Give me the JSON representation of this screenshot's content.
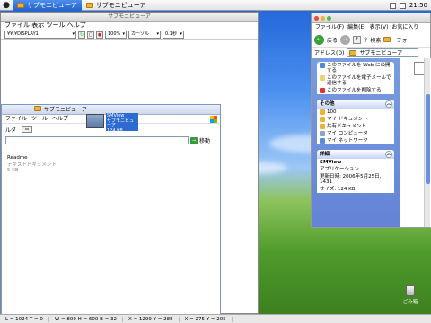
{
  "menubar": {
    "items": [
      "サブモニビューア",
      "サブモニビューア"
    ],
    "clock": "21:50"
  },
  "viewer": {
    "title": "サブモニビューア",
    "menu": "ファイル 表示 ツール ヘルプ",
    "path": "¥¥.¥DISPLAY1",
    "zoom": "100%",
    "cursor_mode": "カーソル",
    "interval": "0.1秒"
  },
  "inner": {
    "title": "サブモニビューア",
    "menu": [
      "ファイル",
      "ツール",
      "ヘルプ"
    ],
    "toolbar_left": "ルダ",
    "go_label": "移動",
    "files": [
      {
        "name": "Readme",
        "type": "テキストドキュメント",
        "size": "5 KB"
      },
      {
        "name": "SMView",
        "type": "サブモニビューア",
        "size": "124 KB"
      }
    ]
  },
  "explorer": {
    "menu": [
      "ファイル(F)",
      "編集(E)",
      "表示(V)",
      "お気に入り"
    ],
    "back": "戻る",
    "search": "検索",
    "folder": "フォ",
    "address_label": "アドレス(D)",
    "address_value": "サブモニビューア",
    "tasks": [
      "このファイルを Web に公開する",
      "このファイルを電子メールで送信する",
      "このファイルを削除する"
    ],
    "other_title": "その他",
    "other_places": [
      "100",
      "マイ ドキュメント",
      "共有ドキュメント",
      "マイ コンピュータ",
      "マイ ネットワーク"
    ],
    "details_title": "詳細",
    "details": {
      "name": "SMView",
      "kind": "アプリケーション",
      "modified": "更新日時: 2006年5月25日, 1431",
      "size": "サイズ: 124 KB"
    }
  },
  "statusbar": [
    "L = 1024  T = 0",
    "W = 800  H = 600  B = 32",
    "X = 1299  Y = 285",
    "X = 275  Y = 205"
  ],
  "trash": {
    "label": "ごみ箱"
  },
  "colors": {
    "selection": "#2e6bd1",
    "task_pane": "#7a9ce0",
    "menubar_active": "#2561c9"
  }
}
